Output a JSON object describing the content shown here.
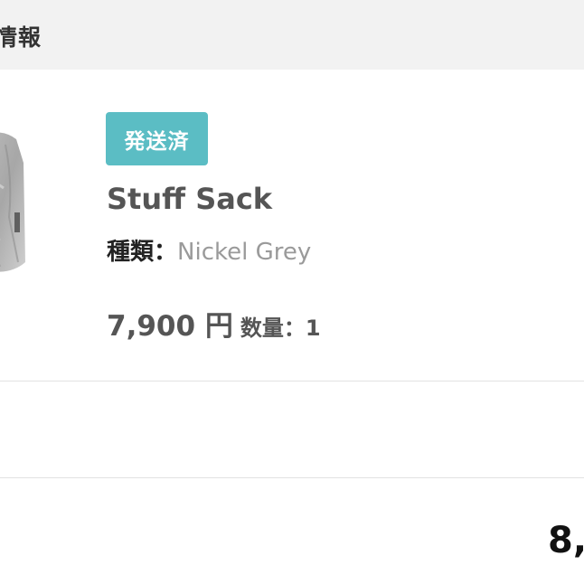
{
  "header": {
    "title": "情報"
  },
  "order_item": {
    "status_badge": "発送済",
    "product_name": "Stuff Sack",
    "variant_label": "種類：",
    "variant_value": "Nickel Grey",
    "price": "7,900 円",
    "quantity": "数量：1",
    "thumbnail_icon": "stuff-sack-product-image"
  },
  "summary": {
    "total_amount_partial": "8,"
  },
  "colors": {
    "header_bg": "#f2f2f2",
    "status_badge_bg": "#5bbdc4",
    "text_primary": "#555555",
    "text_secondary": "#9a9a9a"
  }
}
